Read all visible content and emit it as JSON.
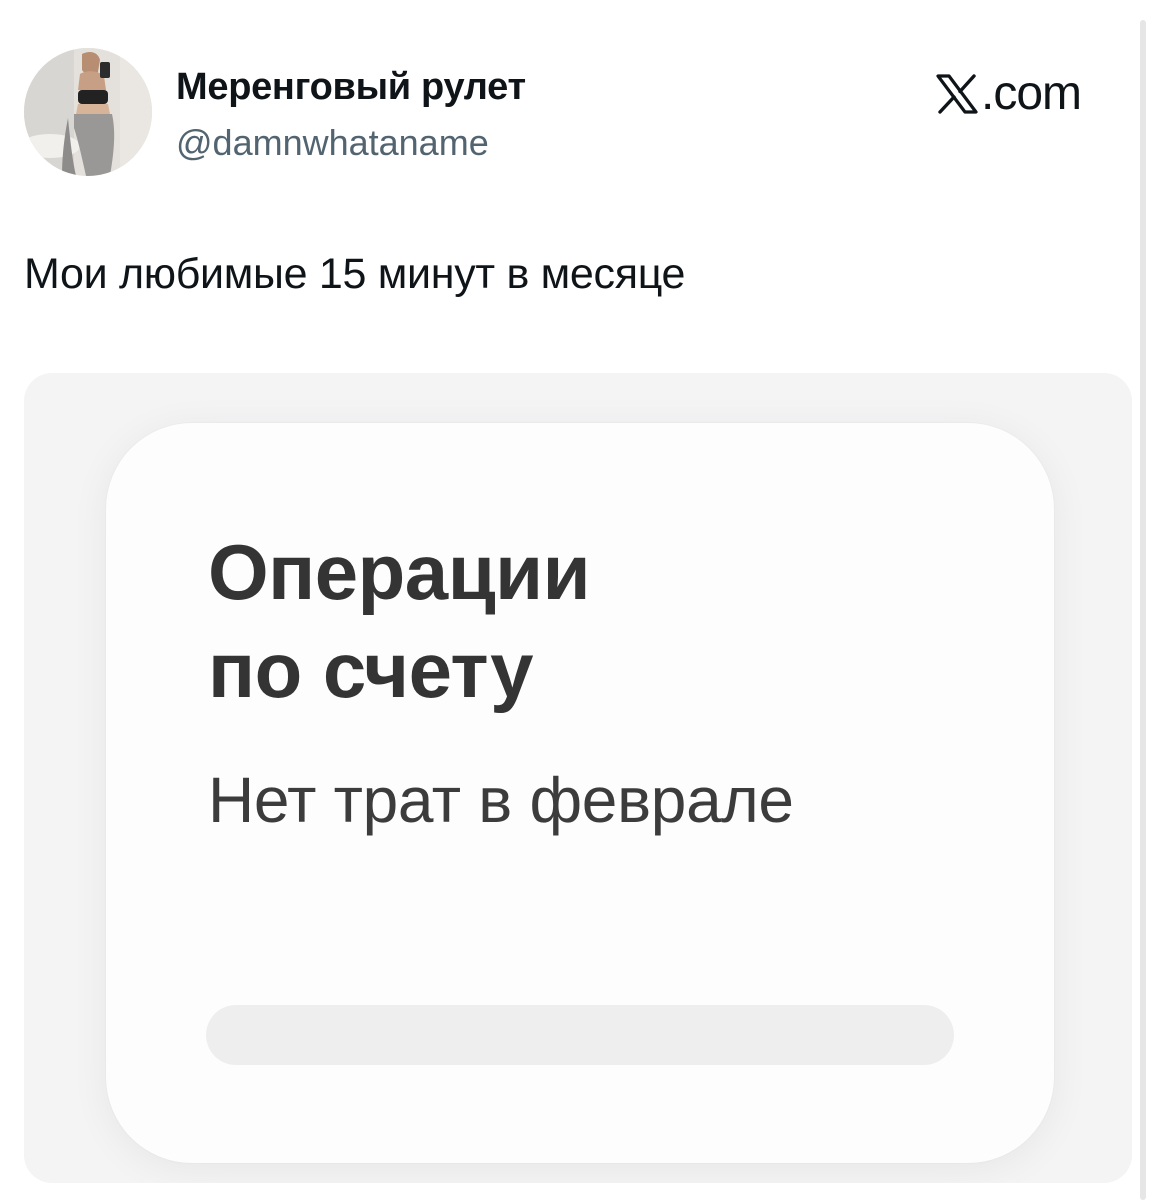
{
  "author": {
    "display_name": "Меренговый рулет",
    "handle": "@damnwhataname",
    "avatar_icon": "profile-photo-avatar"
  },
  "brand": {
    "logo_icon": "x-logo-icon",
    "domain_suffix": ".com"
  },
  "tweet": {
    "text": "Мои любимые 15 минут в месяце"
  },
  "media": {
    "card": {
      "title_line1": "Операции",
      "title_line2": "по счету",
      "subtitle": "Нет трат в феврале"
    }
  },
  "colors": {
    "text_primary": "#0f1419",
    "text_secondary": "#536471",
    "card_text": "#343434",
    "media_bg": "#f4f4f5",
    "placeholder": "#eeeeef"
  }
}
